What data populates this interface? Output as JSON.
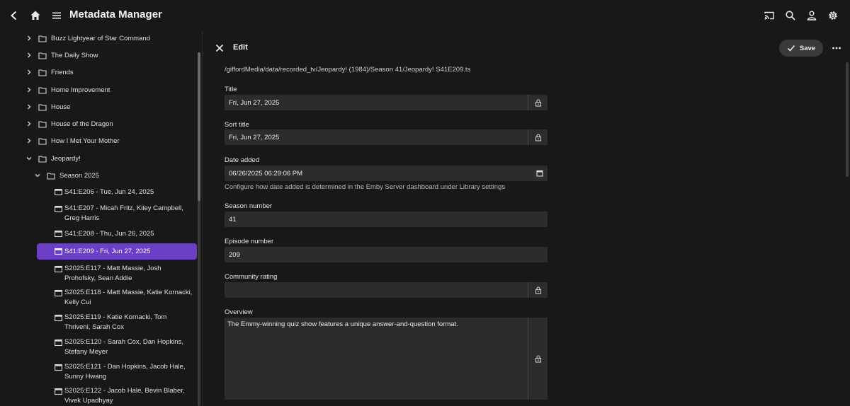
{
  "app": {
    "title": "Metadata Manager"
  },
  "topbar": {
    "back_icon": "chevron-left-icon",
    "home_icon": "home-icon",
    "menu_icon": "hamburger-icon",
    "cast_icon": "cast-icon",
    "search_icon": "search-icon",
    "user_icon": "user-icon",
    "settings_icon": "gear-icon"
  },
  "sidebar": {
    "items": [
      {
        "label": "Buzz Lightyear of Star Command"
      },
      {
        "label": "The Daily Show"
      },
      {
        "label": "Friends"
      },
      {
        "label": "Home Improvement"
      },
      {
        "label": "House"
      },
      {
        "label": "House of the Dragon"
      },
      {
        "label": "How I Met Your Mother"
      },
      {
        "label": "Jeopardy!"
      }
    ],
    "season": {
      "label": "Season 2025"
    },
    "episodes": [
      {
        "label": "S41:E206 - Tue, Jun 24, 2025"
      },
      {
        "label": "S41:E207 - Micah Fritz, Kiley Campbell, Greg Harris"
      },
      {
        "label": "S41:E208 - Thu, Jun 26, 2025"
      },
      {
        "label": "S41:E209 - Fri, Jun 27, 2025"
      },
      {
        "label": "S2025:E117 - Matt Massie, Josh Prohofsky, Sean Addie"
      },
      {
        "label": "S2025:E118 - Matt Massie, Katie Kornacki, Kelly Cui"
      },
      {
        "label": "S2025:E119 - Katie Kornacki, Tom Thriveni, Sarah Cox"
      },
      {
        "label": "S2025:E120 - Sarah Cox, Dan Hopkins, Stefany Meyer"
      },
      {
        "label": "S2025:E121 - Dan Hopkins, Jacob Hale, Sunny Hwang"
      },
      {
        "label": "S2025:E122 - Jacob Hale, Bevin Blaber, Vivek Upadhyay"
      }
    ],
    "selected_color": "#6b3fc4"
  },
  "editor": {
    "title": "Edit",
    "save_label": "Save",
    "path": "/giffordMedia/data/recorded_tv/Jeopardy! (1984)/Season 41/Jeopardy! S41E209.ts",
    "fields": {
      "title": {
        "label": "Title",
        "value": "Fri, Jun 27, 2025"
      },
      "sort_title": {
        "label": "Sort title",
        "value": "Fri, Jun 27, 2025"
      },
      "date_added": {
        "label": "Date added",
        "value": "06/26/2025 06:29:06 PM",
        "hint": "Configure how date added is determined in the Emby Server dashboard under Library settings"
      },
      "season_number": {
        "label": "Season number",
        "value": "41"
      },
      "episode_number": {
        "label": "Episode number",
        "value": "209"
      },
      "community_rating": {
        "label": "Community rating",
        "value": ""
      },
      "overview": {
        "label": "Overview",
        "value": "The Emmy-winning quiz show features a unique answer-and-question format."
      }
    }
  }
}
